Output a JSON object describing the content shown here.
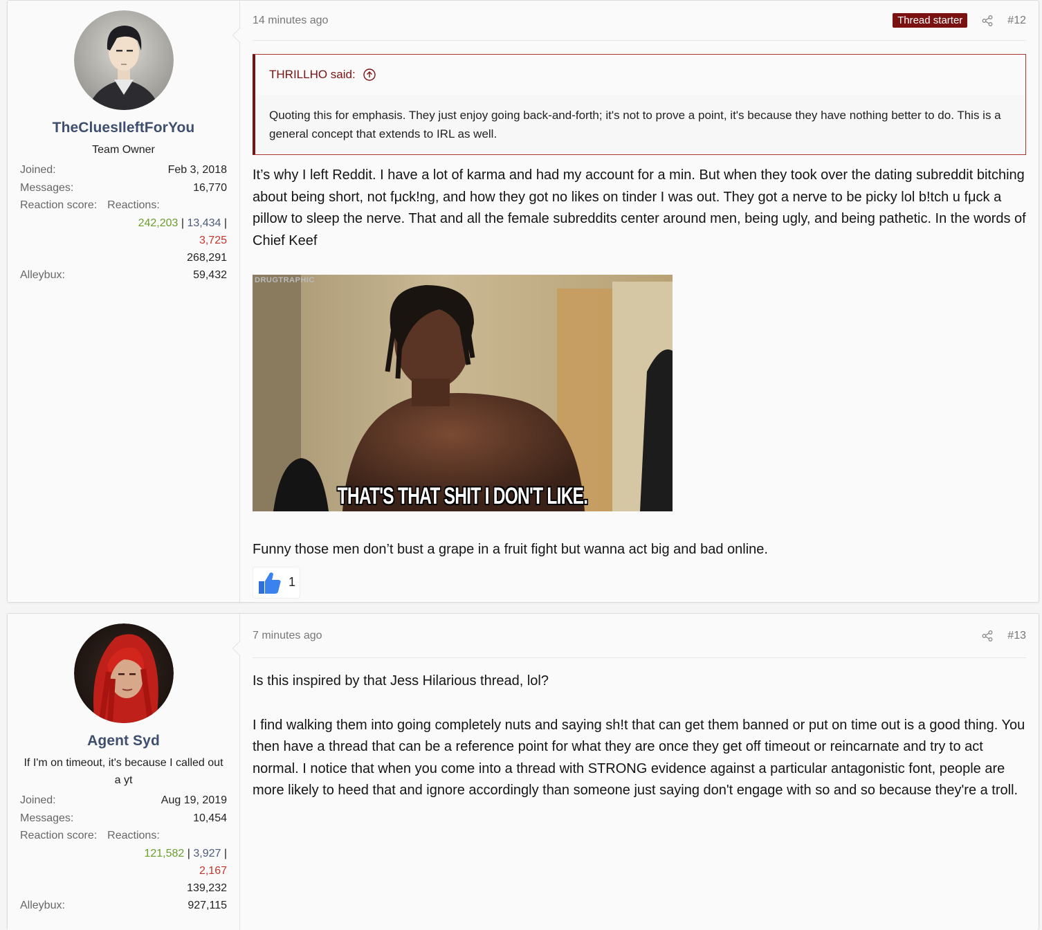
{
  "posts": [
    {
      "username": "TheCluesIleftForYou",
      "usertitle": "Team Owner",
      "joined_label": "Joined:",
      "joined": "Feb 3, 2018",
      "messages_label": "Messages:",
      "messages": "16,770",
      "reaction_label": "Reaction score:",
      "reactions_label": "Reactions:",
      "react_pos": "242,203",
      "react_neu": "13,434",
      "react_neg": "3,725",
      "react_total": "268,291",
      "alleybux_label": "Alleybux:",
      "alleybux": "59,432",
      "time": "14 minutes ago",
      "badge": "Thread starter",
      "number": "#12",
      "quote_author": "THRILLHO said:",
      "quote_text": "Quoting this for emphasis. They just enjoy going back-and-forth; it's not to prove a point, it's because they have nothing better to do. This is a general concept that extends to IRL as well.",
      "body1": "It’s why I left Reddit. I have a lot of karma and had my account for a min. But when they took over the dating subreddit bitching about being short, not fμck!ng, and how they got no likes on tinder I was out. They got a nerve to be picky lol b!tch u fμck a pillow to sleep the nerve. That and all the female subreddits center around men, being ugly, and being pathetic. In the words of Chief Keef",
      "gif_watermark": "DRUGTRAPHIC",
      "gif_caption": "THAT'S THAT SHIT I DON'T LIKE.",
      "body2": "Funny those men don’t bust a grape in a fruit fight but wanna act big and bad online.",
      "like_count": "1"
    },
    {
      "username": "Agent Syd",
      "usertitle": "If I'm on timeout, it's because I called out a yt",
      "joined_label": "Joined:",
      "joined": "Aug 19, 2019",
      "messages_label": "Messages:",
      "messages": "10,454",
      "reaction_label": "Reaction score:",
      "reactions_label": "Reactions:",
      "react_pos": "121,582",
      "react_neu": "3,927",
      "react_neg": "2,167",
      "react_total": "139,232",
      "alleybux_label": "Alleybux:",
      "alleybux": "927,115",
      "time": "7 minutes ago",
      "number": "#13",
      "body1": "Is this inspired by that Jess Hilarious thread, lol?",
      "body2": "I find walking them into going completely nuts and saying sh!t that can get them banned or put on time out is a good thing. You then have a thread that can be a reference point for what they are once they get off timeout or reincarnate and try to act normal. I notice that when you come into a thread with STRONG evidence against a particular antagonistic font, people are more likely to heed that and ignore accordingly than someone just saying don't engage with so and so because they're a troll."
    }
  ],
  "colors": {
    "username": "#3d4e6e",
    "badge": "#7a1212",
    "reaction_positive": "#6a9e2f",
    "reaction_negative": "#c4342c"
  },
  "icons": [
    "share-icon",
    "quote-expand-icon",
    "like-thumb-icon"
  ]
}
